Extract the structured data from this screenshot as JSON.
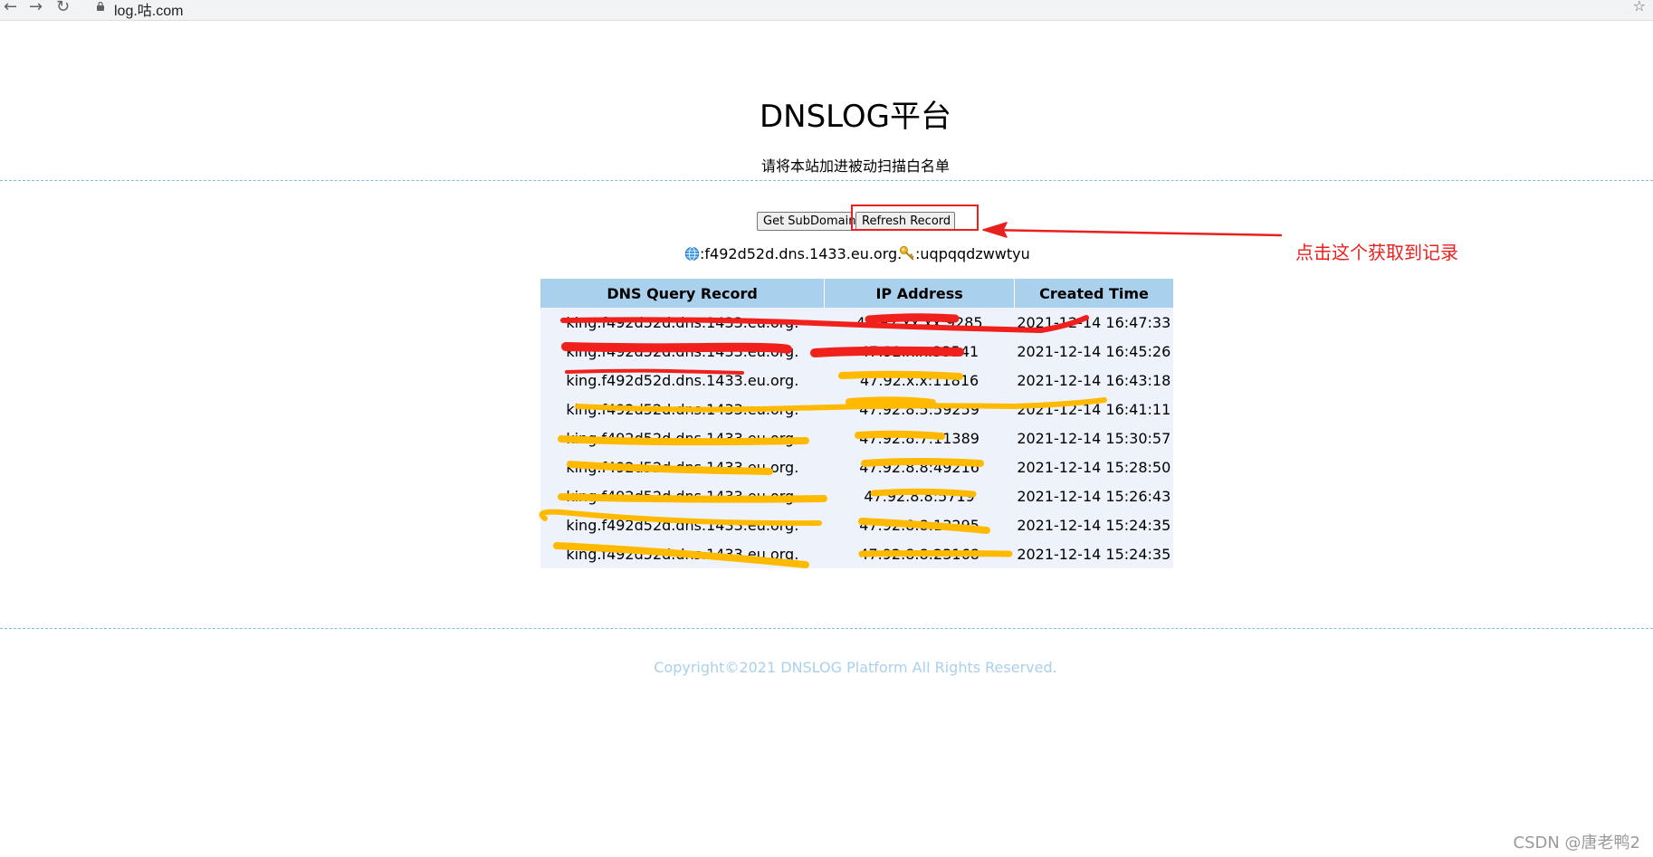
{
  "browser": {
    "url": "log.咕.com",
    "back_icon": "arrow-left-icon",
    "forward_icon": "arrow-right-icon",
    "reload_icon": "reload-icon",
    "lock_icon": "lock-icon",
    "bookmark_icon": "star-icon"
  },
  "header": {
    "title": "DNSLOG平台",
    "subtitle": "请将本站加进被动扫描白名单"
  },
  "actions": {
    "get_subdomain_label": "Get SubDomain",
    "refresh_record_label": "Refresh Record"
  },
  "info": {
    "domain": ":f492d52d.dns.1433.eu.org.",
    "token": ":uqpqqdzwwtyu",
    "domain_icon": "globe-icon",
    "token_icon": "key-icon"
  },
  "table": {
    "headers": [
      "DNS Query Record",
      "IP Address",
      "Created Time"
    ],
    "rows": [
      {
        "dns": "king.f492d52d.dns.1433.eu.org.",
        "ip": "47.92.xx.xx:9285",
        "time": "2021-12-14 16:47:33"
      },
      {
        "dns": "king.f492d52d.dns.1433.eu.org.",
        "ip": "47.92.x.x:33541",
        "time": "2021-12-14 16:45:26"
      },
      {
        "dns": "king.f492d52d.dns.1433.eu.org.",
        "ip": "47.92.x.x:11816",
        "time": "2021-12-14 16:43:18"
      },
      {
        "dns": "king.f492d52d.dns.1433.eu.org.",
        "ip": "47.92.8.5:59259",
        "time": "2021-12-14 16:41:11"
      },
      {
        "dns": "king.f492d52d.dns.1433.eu.org.",
        "ip": "47.92.8.7:11389",
        "time": "2021-12-14 15:30:57"
      },
      {
        "dns": "king.f492d52d.dns.1433.eu.org.",
        "ip": "47.92.8.8:49216",
        "time": "2021-12-14 15:28:50"
      },
      {
        "dns": "king.f492d52d.dns.1433.eu.org.",
        "ip": "47.92.8.8:5719",
        "time": "2021-12-14 15:26:43"
      },
      {
        "dns": "king.f492d52d.dns.1433.eu.org.",
        "ip": "47.92.8.8:13295",
        "time": "2021-12-14 15:24:35"
      },
      {
        "dns": "king.f492d52d.dns.1433.eu.org.",
        "ip": "47.92.8.8:23168",
        "time": "2021-12-14 15:24:35"
      }
    ]
  },
  "annotation": {
    "text": "点击这个获取到记录",
    "color": "#e8211e"
  },
  "footer": {
    "copyright": "Copyright©2021 DNSLOG Platform All Rights Reserved."
  },
  "watermark": {
    "text": "CSDN @唐老鸭2"
  },
  "colors": {
    "header_bg": "#a9d0ec",
    "table_bg": "#eef2fb",
    "divider": "#7bbfe0",
    "redaction_red": "#f0201c",
    "redaction_yellow": "#ffba00"
  }
}
